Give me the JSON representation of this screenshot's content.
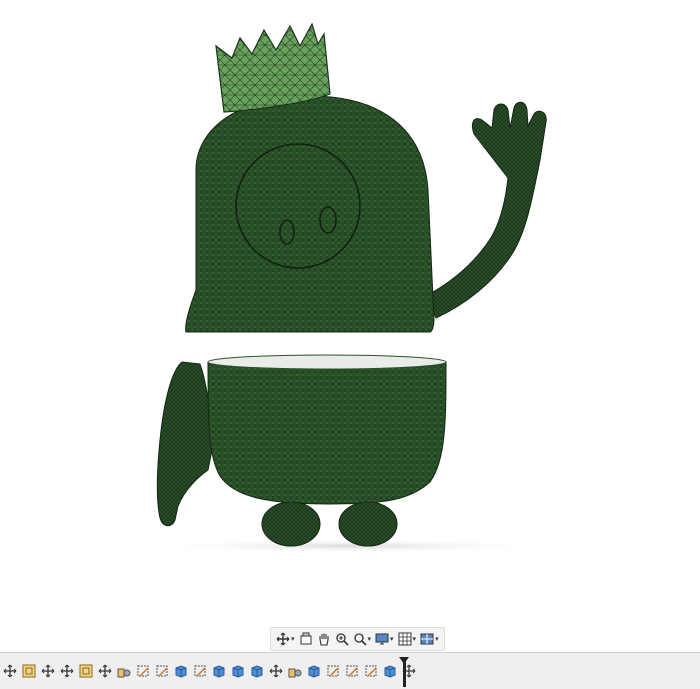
{
  "colors": {
    "mesh_dark": "#1f3a1f",
    "mesh_green": "#2e5a2c",
    "crown_green": "#6aa35e",
    "background": "#ffffff",
    "toolbar_bg": "#f4f4f4",
    "timeline_bg": "#efefef"
  },
  "view_toolbar": {
    "tools": [
      {
        "icon": "orbit-icon",
        "has_dropdown": true
      },
      {
        "icon": "look-at-icon",
        "has_dropdown": false
      },
      {
        "icon": "pan-hand-icon",
        "has_dropdown": false
      },
      {
        "icon": "zoom-window-icon",
        "has_dropdown": false
      },
      {
        "icon": "fit-zoom-icon",
        "has_dropdown": true
      },
      {
        "icon": "display-settings-icon",
        "has_dropdown": true
      },
      {
        "icon": "grid-settings-icon",
        "has_dropdown": true
      },
      {
        "icon": "viewports-icon",
        "has_dropdown": true
      }
    ]
  },
  "timeline": {
    "items": [
      "move-icon",
      "sketch-icon",
      "move-icon",
      "move-icon",
      "sketch-icon",
      "move-icon",
      "component-icon",
      "sketch-plane-icon",
      "sketch-plane-icon",
      "body-icon",
      "sketch-plane-icon",
      "body-icon",
      "body-icon",
      "body-icon",
      "move-icon",
      "component-icon",
      "body-icon",
      "sketch-plane-icon",
      "sketch-plane-icon",
      "sketch-plane-icon",
      "body-icon",
      "move-icon"
    ]
  }
}
